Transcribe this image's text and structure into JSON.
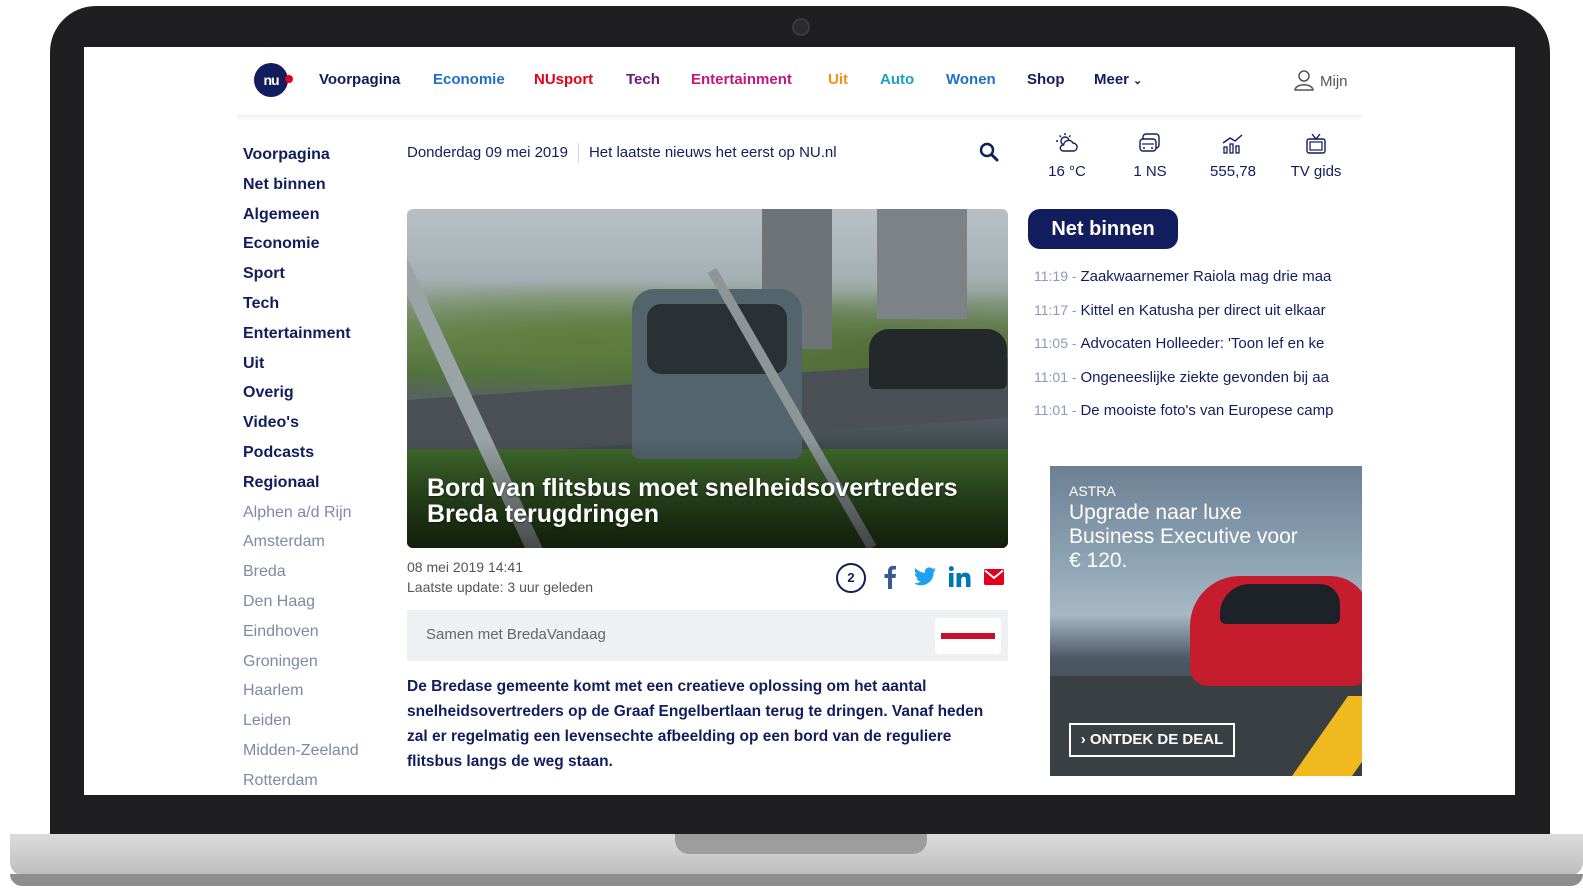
{
  "nav": {
    "logo": "nu",
    "items": [
      {
        "label": "Voorpagina",
        "color": "#121d5d"
      },
      {
        "label": "Economie",
        "color": "#1f6fc2"
      },
      {
        "label": "NUsport",
        "color": "#e3001b"
      },
      {
        "label": "Tech",
        "color": "#6b1a7a"
      },
      {
        "label": "Entertainment",
        "color": "#c2187a"
      },
      {
        "label": "Uit",
        "color": "#f2901a"
      },
      {
        "label": "Auto",
        "color": "#1aa0c8"
      },
      {
        "label": "Wonen",
        "color": "#1f6fc2"
      },
      {
        "label": "Shop",
        "color": "#121d5d"
      },
      {
        "label": "Meer",
        "color": "#121d5d"
      }
    ],
    "user_label": "Mijn"
  },
  "sidebar": {
    "sections": [
      "Voorpagina",
      "Net binnen",
      "Algemeen",
      "Economie",
      "Sport",
      "Tech",
      "Entertainment",
      "Uit",
      "Overig",
      "Video's",
      "Podcasts",
      "Regionaal"
    ],
    "regions": [
      "Alphen a/d Rijn",
      "Amsterdam",
      "Breda",
      "Den Haag",
      "Eindhoven",
      "Groningen",
      "Haarlem",
      "Leiden",
      "Midden-Zeeland",
      "Rotterdam"
    ]
  },
  "header": {
    "date": "Donderdag 09 mei 2019",
    "tagline": "Het laatste nieuws het eerst op NU.nl"
  },
  "article": {
    "title": "Bord van flitsbus moet snelheidsovertreders Breda terugdringen",
    "published": "08 mei 2019 14:41",
    "updated": "Laatste update: 3 uur geleden",
    "comments": "2",
    "partner": "Samen met BredaVandaag",
    "lead": "De Bredase gemeente komt met een creatieve oplossing om het aantal snelheidsovertreders op de Graaf Engelbertlaan terug te dringen. Vanaf heden zal er regelmatig een levensechte afbeelding op een bord van de reguliere flitsbus langs de weg staan."
  },
  "widgets": [
    {
      "icon": "weather-icon",
      "value": "16 °C"
    },
    {
      "icon": "train-icon",
      "value": "1 NS"
    },
    {
      "icon": "stock-chart-icon",
      "value": "555,78"
    },
    {
      "icon": "tv-icon",
      "value": "TV gids"
    }
  ],
  "net_binnen": {
    "title": "Net binnen",
    "items": [
      {
        "time": "11:19",
        "text": "Zaakwaarnemer Raiola mag drie maa"
      },
      {
        "time": "11:17",
        "text": "Kittel en Katusha per direct uit elkaar"
      },
      {
        "time": "11:05",
        "text": "Advocaten Holleeder: 'Toon lef en ke"
      },
      {
        "time": "11:01",
        "text": "Ongeneeslijke ziekte gevonden bij aa"
      },
      {
        "time": "11:01",
        "text": "De mooiste foto's van Europese camp"
      }
    ]
  },
  "ad": {
    "brand": "ASTRA",
    "headline": "Upgrade naar luxe Business Executive voor € 120.",
    "cta": "ONTDEK DE DEAL"
  },
  "colors": {
    "navy": "#121d5d",
    "region_gray": "#7c8aa5",
    "time_gray": "#8a9bb9",
    "share_blue": "#3b5998",
    "twitter": "#1da1f2",
    "linkedin": "#0077b5",
    "mail_red": "#e3001b"
  }
}
